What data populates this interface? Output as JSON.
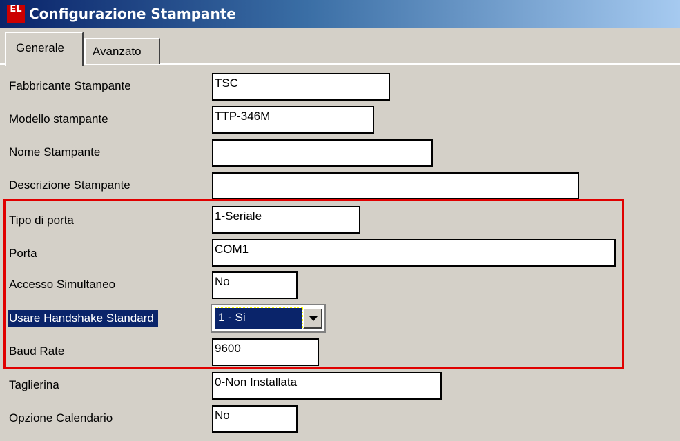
{
  "window": {
    "title": "Configurazione Stampante",
    "app_icon_text": "EL"
  },
  "tabs": [
    {
      "label": "Generale",
      "active": true
    },
    {
      "label": "Avanzato",
      "active": false
    }
  ],
  "fields": {
    "fabbricante": {
      "label": "Fabbricante Stampante",
      "value": "TSC"
    },
    "modello": {
      "label": "Modello stampante",
      "value": "TTP-346M"
    },
    "nome": {
      "label": "Nome Stampante",
      "value": ""
    },
    "descrizione": {
      "label": "Descrizione Stampante",
      "value": ""
    },
    "tipo_porta": {
      "label": "Tipo di porta",
      "value": "1-Seriale"
    },
    "porta": {
      "label": "Porta",
      "value": "COM1"
    },
    "accesso": {
      "label": "Accesso Simultaneo",
      "value": "No"
    },
    "handshake": {
      "label": "Usare Handshake Standard",
      "value": "1 - Si"
    },
    "baud": {
      "label": "Baud Rate",
      "value": "9600"
    },
    "taglierina": {
      "label": "Taglierina",
      "value": "0-Non Installata"
    },
    "calendario": {
      "label": "Opzione Calendario",
      "value": "No"
    }
  },
  "colors": {
    "highlight_box": "#e00000",
    "selection": "#0a246a",
    "window_bg": "#d4d0c8"
  }
}
